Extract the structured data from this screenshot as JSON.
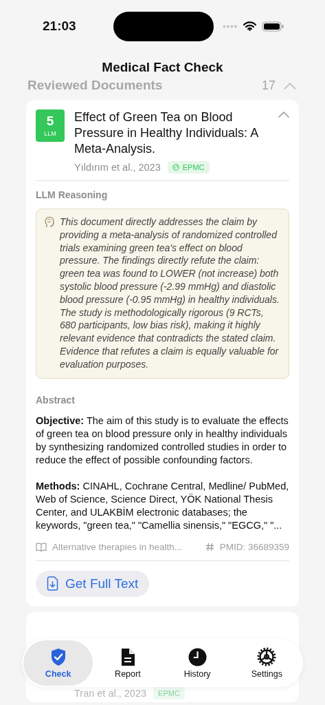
{
  "status_bar": {
    "time": "21:03"
  },
  "nav": {
    "title": "Medical Fact Check"
  },
  "section": {
    "title": "Reviewed Documents",
    "count": "17",
    "expanded": true
  },
  "documents": [
    {
      "score": "5",
      "score_label": "LLM",
      "title": "Effect of Green Tea on Blood Pressure in Healthy Individuals: A Meta-Analysis.",
      "authors": "Yıldırım et al., 2023",
      "source": "EPMC",
      "expanded": true,
      "reasoning_label": "LLM Reasoning",
      "reasoning": "This document directly addresses the claim by providing a meta-analysis of randomized controlled trials examining green tea's effect on blood pressure. The findings directly refute the claim: green tea was found to LOWER (not increase) both systolic blood pressure (-2.99 mmHg) and diastolic blood pressure (-0.95 mmHg) in healthy individuals. The study is methodologically rigorous (9 RCTs, 680 participants, low bias risk), making it highly relevant evidence that contradicts the stated claim. Evidence that refutes a claim is equally valuable for evaluation purposes.",
      "abstract_label": "Abstract",
      "abstract": [
        "**Objective:** The aim of this study is to evaluate the effects of green tea on blood pressure only in healthy individuals by synthesizing randomized controlled studies in order to reduce the effect of possible confounding factors.",
        "**Methods:** CINAHL, Cochrane Central, Medline/ PubMed, Web of Science, Science Direct, YÖK National Thesis Center, and ULAKBİM electronic databases; the keywords, \"green tea,\" \"Camellia sinensis,\" \"EGCG,\" \"..."
      ],
      "journal": "Alternative therapies in health...",
      "pmid": "PMID: 36689359",
      "action": "Get Full Text"
    },
    {
      "authors": "Tran et al., 2023",
      "source": "EPMC"
    }
  ],
  "tab_bar": [
    {
      "label": "Check",
      "selected": true
    },
    {
      "label": "Report",
      "selected": false
    },
    {
      "label": "History",
      "selected": false
    },
    {
      "label": "Settings",
      "selected": false
    }
  ]
}
